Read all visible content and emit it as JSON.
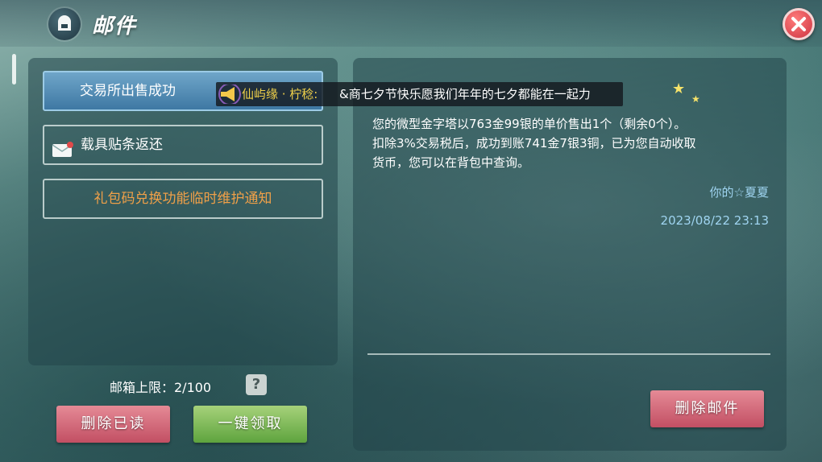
{
  "header": {
    "title": "邮件"
  },
  "mail_list": [
    {
      "label": "交易所出售成功",
      "selected": true
    },
    {
      "label": "载具贴条返还",
      "selected": false
    },
    {
      "label": "礼包码兑换功能临时维护通知",
      "selected": false
    }
  ],
  "broadcast": {
    "server": "仙屿缘 · 柠稔:",
    "message": "&商七夕节快乐愿我们年年的七夕都能在一起力"
  },
  "mail_detail": {
    "body_line1": "您的微型金字塔以763金99银的单价售出1个（剩余0个）。",
    "body_line2": "扣除3%交易税后，成功到账741金7银3铜，已为您自动收取",
    "body_line3": "货币，您可以在背包中查询。",
    "sender": "你的☆夏夏",
    "date": "2023/08/22 23:13"
  },
  "footer": {
    "mailbox_limit": "邮箱上限：2/100",
    "help_label": "?",
    "delete_read_label": "删除已读",
    "claim_all_label": "一键领取",
    "delete_mail_label": "删除邮件"
  },
  "colors": {
    "accent_blue": "#4d86b2",
    "link_blue": "#9fd4f0",
    "orange_text": "#f0a048",
    "close_red": "#d23a48"
  }
}
